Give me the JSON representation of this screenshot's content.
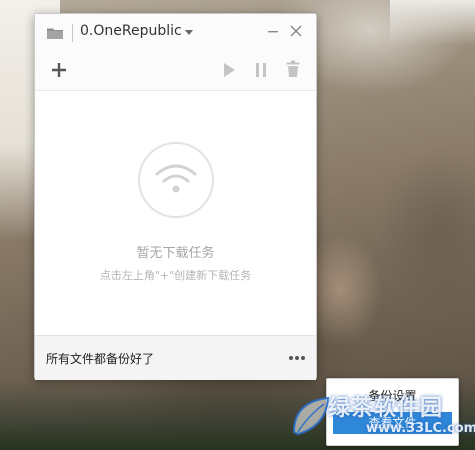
{
  "window": {
    "title": "0.OneRepublic",
    "icons": {
      "folder": "folder-icon",
      "dropdown": "chevron-down-icon",
      "minimize": "minimize-icon",
      "close": "close-icon"
    }
  },
  "toolbar": {
    "icons": [
      "plus-icon",
      "play-icon",
      "pause-icon",
      "trash-icon"
    ]
  },
  "empty_state": {
    "icon": "wifi-icon",
    "title": "暂无下载任务",
    "hint": "点击左上角\"+\"创建新下载任务"
  },
  "footer": {
    "status": "所有文件都备份好了",
    "more_icon": "more-icon"
  },
  "popup_menu": {
    "items": [
      "备份设置",
      "查看文件"
    ],
    "selected_index": 1
  },
  "watermark": {
    "text": "绿茶软件园",
    "url": "www.33LC.com"
  },
  "colors": {
    "accent": "#2f87d8",
    "muted_text": "#a6a6a6",
    "icon_gray": "#bcbcbc"
  }
}
